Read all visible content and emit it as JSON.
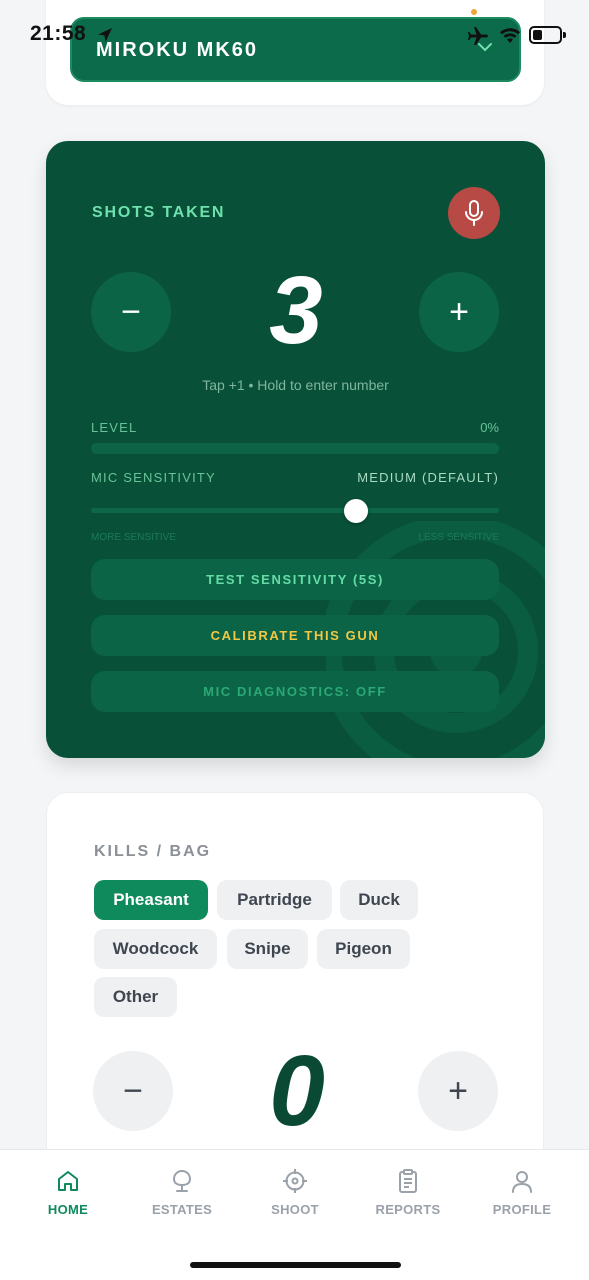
{
  "status_bar": {
    "time": "21:58"
  },
  "gun_selector": {
    "name": "MIROKU MK60"
  },
  "shots": {
    "title": "SHOTS TAKEN",
    "count": "3",
    "minus_label": "−",
    "plus_label": "+",
    "hint": "Tap +1 • Hold to enter number",
    "level_label": "LEVEL",
    "level_value": "0%",
    "level_fraction": 0,
    "sensitivity_label": "MIC SENSITIVITY",
    "sensitivity_value": "MEDIUM (DEFAULT)",
    "sensitivity_fraction": 0.65,
    "slider_min_label": "MORE SENSITIVE",
    "slider_max_label": "LESS SENSITIVE",
    "test_button": "TEST SENSITIVITY (5S)",
    "calibrate_button": "CALIBRATE THIS GUN",
    "diagnostics_button": "MIC DIAGNOSTICS: OFF"
  },
  "kills": {
    "title": "KILLS / BAG",
    "species": [
      {
        "label": "Pheasant",
        "active": true
      },
      {
        "label": "Partridge",
        "active": false
      },
      {
        "label": "Duck",
        "active": false
      },
      {
        "label": "Woodcock",
        "active": false
      },
      {
        "label": "Snipe",
        "active": false
      },
      {
        "label": "Pigeon",
        "active": false
      },
      {
        "label": "Other",
        "active": false
      }
    ],
    "count": "0",
    "minus_label": "−",
    "plus_label": "+"
  },
  "nav": {
    "items": [
      {
        "label": "HOME",
        "icon": "home-icon",
        "active": true
      },
      {
        "label": "ESTATES",
        "icon": "tree-icon",
        "active": false
      },
      {
        "label": "SHOOT",
        "icon": "crosshair-icon",
        "active": false
      },
      {
        "label": "REPORTS",
        "icon": "clipboard-icon",
        "active": false
      },
      {
        "label": "PROFILE",
        "icon": "user-icon",
        "active": false
      }
    ]
  },
  "colors": {
    "brand_green": "#0b6b4a",
    "card_dark_green": "#085037",
    "accent_mint": "#6fe0ae",
    "mic_red": "#b84a45",
    "calibrate_yellow": "#f2c744",
    "active_chip": "#0f8a5c"
  }
}
